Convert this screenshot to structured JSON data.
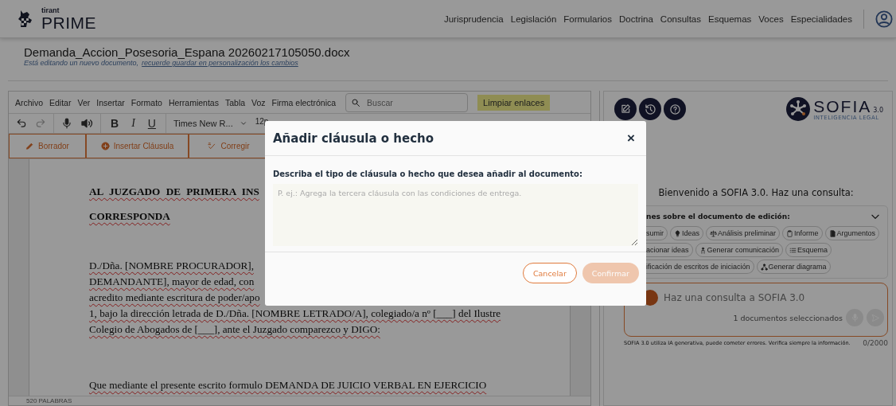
{
  "header": {
    "logo_top": "tirant",
    "logo_main": "PRIME",
    "nav": [
      "Jurisprudencia",
      "Legislación",
      "Formularios",
      "Doctrina",
      "Consultas",
      "Esquemas",
      "Voces",
      "Especialidades"
    ]
  },
  "document": {
    "title": "Demanda_Accion_Posesoria_Espana 20260217105050.docx",
    "notice": "Está editando un nuevo documento,",
    "notice_link": "recuerde guardar en personalización los cambios"
  },
  "editor": {
    "menu": [
      "Archivo",
      "Editar",
      "Ver",
      "Insertar",
      "Formato",
      "Herramientas",
      "Tabla",
      "Voz",
      "Firma electrónica"
    ],
    "search": {
      "placeholder": "Buscar"
    },
    "clear_links_button": "Limpiar enlaces",
    "format_buttons": [
      "B",
      "I",
      "U"
    ],
    "font": "Times New R...",
    "font_size": "12p",
    "actions": [
      "Borrador",
      "Insertar Cláusula",
      "Corregir"
    ],
    "heading_lines": [
      "AL JUZGADO DE PRIMERA INS",
      "CORRESPONDA"
    ],
    "paragraph_lines": [
      "D./Dña. [NOMBRE PROCURADOR],",
      "DEMANDANTE], mayor de edad, con",
      "acredito mediante escritura de poder/apo",
      "1, bajo la dirección letrada de D./Dña. [NOMBRE LETRADO/A], colegiado/a nº [___] del Ilustre",
      "Colegio de Abogados de [___], ante el Juzgado comparezco y DIGO:"
    ],
    "closing_line": "Que mediante el presente escrito formulo DEMANDA DE JUICIO VERBAL EN EJERCICIO",
    "word_count": "520 PALABRAS"
  },
  "sofia": {
    "logo": "SOFIA",
    "version": "3.0",
    "tagline": "INTELIGENCIA LEGAL",
    "welcome": "Bienvenido a SOFIA 3.0. Haz una consulta:",
    "suggestions_title": "nes sobre el documento de edición:",
    "chip_rows": [
      [
        "sumir",
        "Ideas",
        "Análisis preliminar",
        "Informe",
        "Argumentos"
      ],
      [
        "acionar ideas",
        "Generar comunicación",
        "Esquema"
      ],
      [
        "ificación de escritos de iniciación",
        "Generar diagrama"
      ]
    ],
    "query": {
      "placeholder": "Haz una consulta a SOFIA 3.0"
    },
    "selected_docs": "1 documentos seleccionados",
    "disclaimer": "SOFIA 3.0 utiliza IA generativa, puede cometer errores. Verifica siempre la información.",
    "counter": "0/2000"
  },
  "modal": {
    "title": "Añadir cláusula o hecho",
    "close": "×",
    "label": "Describa el tipo de cláusula o hecho que desea añadir al documento:",
    "textarea": {
      "placeholder": "P. ej.: Agrega la tercera cláusula con las condiciones de entrega."
    },
    "buttons": [
      {
        "label": "Cancelar",
        "kind": "outline",
        "disabled": false
      },
      {
        "label": "Confirmar",
        "kind": "primary",
        "disabled": true
      }
    ]
  }
}
